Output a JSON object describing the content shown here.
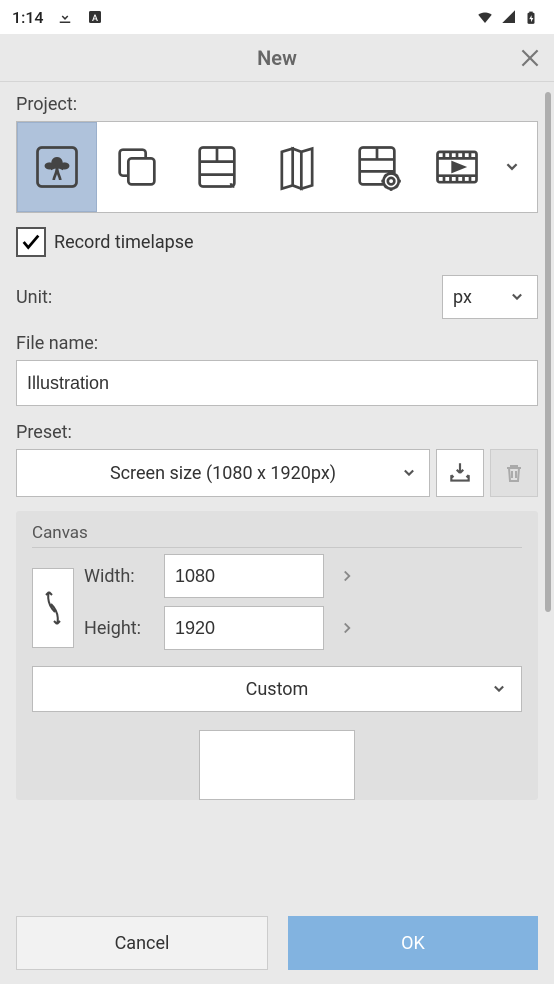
{
  "status": {
    "time": "1:14",
    "icons": [
      "download-icon",
      "app-update-icon",
      "wifi-icon",
      "signal-icon",
      "battery-charging-icon"
    ]
  },
  "dialog": {
    "title": "New"
  },
  "project": {
    "label": "Project:",
    "types": [
      {
        "name": "illustration",
        "selected": true
      },
      {
        "name": "layers",
        "selected": false
      },
      {
        "name": "comic-page",
        "selected": false
      },
      {
        "name": "folded",
        "selected": false
      },
      {
        "name": "comic-settings",
        "selected": false
      },
      {
        "name": "animation",
        "selected": false
      }
    ]
  },
  "timelapse": {
    "checked": true,
    "label": "Record timelapse"
  },
  "unit": {
    "label": "Unit:",
    "value": "px"
  },
  "filename": {
    "label": "File name:",
    "value": "Illustration"
  },
  "preset": {
    "label": "Preset:",
    "value": "Screen size (1080 x 1920px)"
  },
  "canvas": {
    "title": "Canvas",
    "width_label": "Width:",
    "width": "1080",
    "height_label": "Height:",
    "height": "1920",
    "ratio": "Custom"
  },
  "footer": {
    "cancel": "Cancel",
    "ok": "OK"
  }
}
